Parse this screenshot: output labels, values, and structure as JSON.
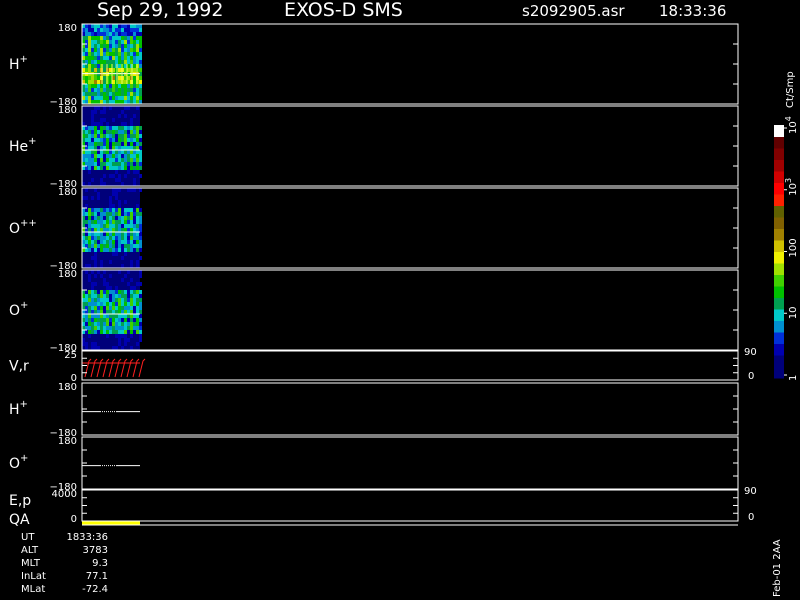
{
  "header": {
    "date": "Sep 29, 1992",
    "instrument": "EXOS-D SMS",
    "file": "s2092905.asr",
    "time": "18:33:36"
  },
  "colorbar": {
    "unit": "Ct/Smp",
    "ticks": [
      {
        "label": "1",
        "value": 1
      },
      {
        "label": "10",
        "value": 10
      },
      {
        "label": "100",
        "value": 100
      },
      {
        "label": "10",
        "sup": "3",
        "value": 1000
      },
      {
        "label": "10",
        "sup": "4",
        "value": 10000
      }
    ],
    "colors": [
      "#00007a",
      "#00007a",
      "#0000b0",
      "#0030d8",
      "#0090d0",
      "#00c8c8",
      "#00a050",
      "#00c000",
      "#40d000",
      "#a0e000",
      "#f0f000",
      "#d0c000",
      "#a08000",
      "#806000",
      "#606000",
      "#ff2000",
      "#ff0000",
      "#d00000",
      "#a00000",
      "#800000",
      "#600000",
      "#ffffff"
    ]
  },
  "footer": {
    "stamp": "Feb-01 2AA",
    "rows": [
      {
        "label": "UT",
        "value": "1833:36"
      },
      {
        "label": "ALT",
        "value": "3783"
      },
      {
        "label": "MLT",
        "value": "9.3"
      },
      {
        "label": "InLat",
        "value": "77.1"
      },
      {
        "label": "MLat",
        "value": "-72.4"
      }
    ]
  },
  "chart_data": {
    "type": "heatmap",
    "panels": [
      {
        "kind": "spectrogram",
        "label": "H",
        "sup": "+",
        "ylim": [
          -180,
          180
        ],
        "ytick_top": "180",
        "ytick_bottom": "−180",
        "intensity": "high"
      },
      {
        "kind": "spectrogram",
        "label": "He",
        "sup": "+",
        "ylim": [
          -180,
          180
        ],
        "ytick_top": "180",
        "ytick_bottom": "−180",
        "intensity": "low"
      },
      {
        "kind": "spectrogram",
        "label": "O",
        "sup": "++",
        "ylim": [
          -180,
          180
        ],
        "ytick_top": "180",
        "ytick_bottom": "−180",
        "intensity": "low"
      },
      {
        "kind": "spectrogram",
        "label": "O",
        "sup": "+",
        "ylim": [
          -180,
          180
        ],
        "ytick_top": "180",
        "ytick_bottom": "−180",
        "intensity": "low"
      },
      {
        "kind": "line",
        "label": "V,r",
        "sup": "",
        "ylim": [
          0,
          25
        ],
        "ytick_top": "25",
        "ytick_bottom": "0",
        "right_top": "90",
        "right_bottom": "0",
        "color": "#ff2020"
      },
      {
        "kind": "trace",
        "label": "H",
        "sup": "+",
        "ylim": [
          -180,
          180
        ],
        "ytick_top": "180",
        "ytick_bottom": "−180",
        "color": "#ffffff"
      },
      {
        "kind": "trace",
        "label": "O",
        "sup": "+",
        "ylim": [
          -180,
          180
        ],
        "ytick_top": "180",
        "ytick_bottom": "−180",
        "color": "#ffffff"
      },
      {
        "kind": "line",
        "label": "E,p",
        "sup": "",
        "ylim": [
          0,
          4000
        ],
        "ytick_top": "4000",
        "ytick_bottom": "0",
        "right_top": "90",
        "right_bottom": "0",
        "color": "#ffffff"
      },
      {
        "kind": "bar",
        "label": "QA",
        "sup": "",
        "color": "#ffff00"
      }
    ]
  }
}
